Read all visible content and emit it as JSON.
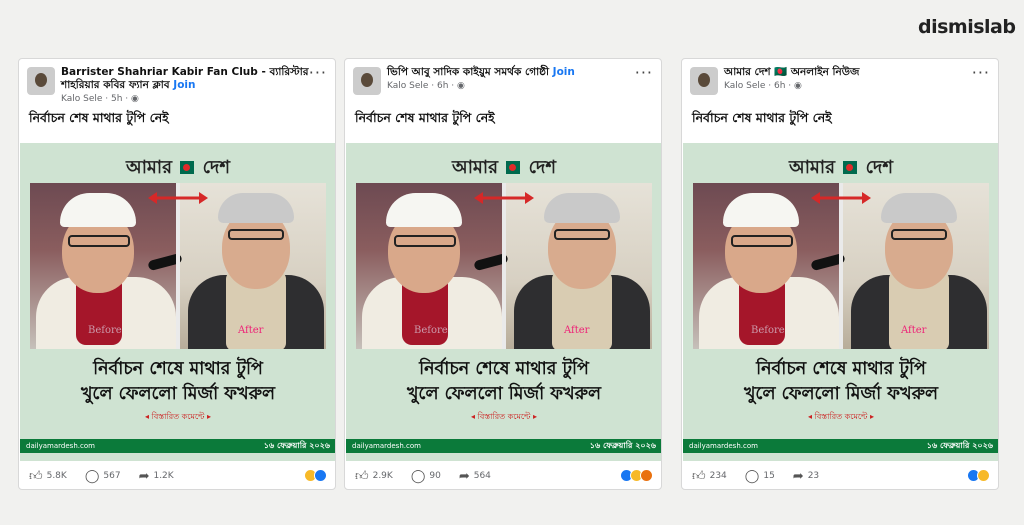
{
  "brand": "dismislab",
  "cards": [
    {
      "group_name": "Barrister Shahriar Kabir Fan Club - ব্যারিস্টার শাহরিয়ার কবির ফ্যান ক্লাব",
      "join": "Join",
      "meta": "Kalo Sele · 5h ·",
      "caption": "নির্বাচন শেষ মাথার টুপি নেই",
      "likes": "5.8K",
      "comments": "567",
      "shares": "1.2K",
      "emoji": [
        "haha",
        "like"
      ]
    },
    {
      "group_name": "ভিপি আবু সাদিক কাইয়ুম সমর্থক গোষ্ঠী",
      "join": "Join",
      "meta": "Kalo Sele · 6h ·",
      "caption": "নির্বাচন শেষ মাথার টুপি নেই",
      "likes": "2.9K",
      "comments": "90",
      "shares": "564",
      "emoji": [
        "like",
        "haha",
        "angry"
      ]
    },
    {
      "group_name": "আমার দেশ 🇧🇩 অনলাইন নিউজ",
      "join": "",
      "meta": "Kalo Sele · 6h ·",
      "caption": "নির্বাচন শেষ মাথার টুপি নেই",
      "likes": "234",
      "comments": "15",
      "shares": "23",
      "emoji": [
        "like",
        "haha"
      ]
    }
  ],
  "post_image": {
    "paper_left": "আমার",
    "paper_right": "দেশ",
    "label_before": "Before",
    "label_after": "After",
    "headline_1": "নির্বাচন শেষে মাথার টুপি",
    "headline_2": "খুলে ফেললো মির্জা ফখরুল",
    "see_comment": "বিস্তারিত কমেন্টে",
    "site": "dailyamardesh.com",
    "date": "১৬ ফেব্রুয়ারি ২০২৬"
  },
  "colors": {
    "accent_green": "#0b7a3a",
    "post_bg": "#cfe3d2",
    "arrow_red": "#d62828",
    "link_blue": "#1877f2"
  }
}
